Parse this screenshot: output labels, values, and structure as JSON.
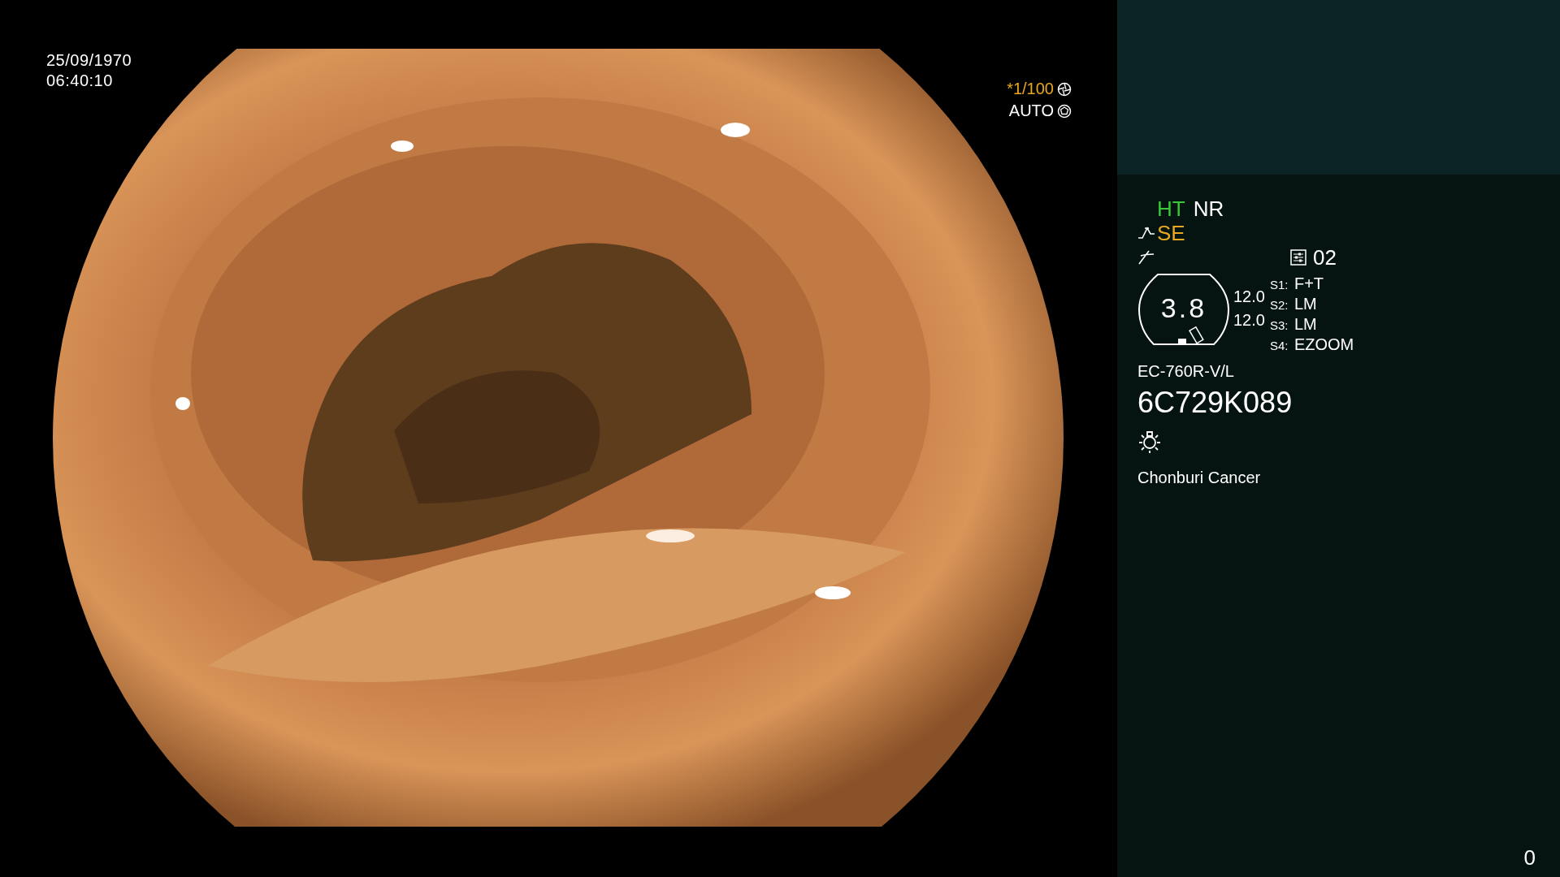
{
  "datetime": {
    "date": "25/09/1970",
    "time": "06:40:10"
  },
  "exposure": [
    {
      "text": "*1/100",
      "kind": "shutter",
      "color": "#e8a820"
    },
    {
      "text": "AUTO",
      "kind": "iris",
      "color": "#ffffff"
    }
  ],
  "modes": [
    {
      "label": "HT",
      "color": "#38c838"
    },
    {
      "label": "NR",
      "color": "#ffffff"
    }
  ],
  "enhancement": {
    "label": "SE"
  },
  "preset": "02",
  "gauge": {
    "value": "3.8"
  },
  "readings": [
    "12.0",
    "12.0"
  ],
  "switches": [
    {
      "key": "S1:",
      "value": "F+T"
    },
    {
      "key": "S2:",
      "value": "LM"
    },
    {
      "key": "S3:",
      "value": "LM"
    },
    {
      "key": "S4:",
      "value": "EZOOM"
    }
  ],
  "scope_model": "EC-760R-V/L",
  "serial": "6C729K089",
  "institution": "Chonburi Cancer",
  "counter": "0"
}
